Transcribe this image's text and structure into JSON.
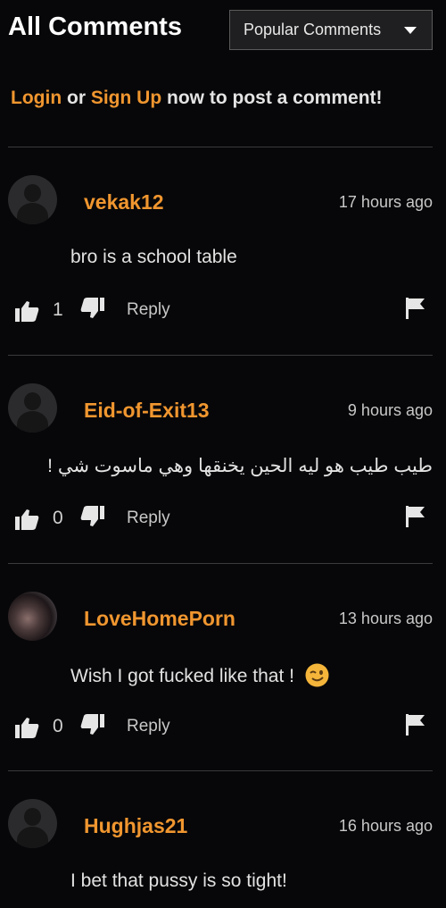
{
  "header": {
    "title": "All Comments",
    "sort_selected": "Popular Comments"
  },
  "login_prompt": {
    "login": "Login",
    "or": "or",
    "sign_up": "Sign Up",
    "rest": "now to post a comment!"
  },
  "colors": {
    "accent": "#f0962f",
    "background": "#070709",
    "divider": "#3a3a3d"
  },
  "comments": [
    {
      "username": "vekak12",
      "time": "17 hours ago",
      "text": "bro is a school table",
      "likes": "1",
      "reply_label": "Reply",
      "avatar": "default-avatar-icon"
    },
    {
      "username": "Eid-of-Exit13",
      "time": "9 hours ago",
      "text": "طيب طيب هو ليه الحين يخنقها وهي ماسوت شي !",
      "likes": "0",
      "reply_label": "Reply",
      "avatar": "default-avatar-icon"
    },
    {
      "username": "LoveHomePorn",
      "time": "13 hours ago",
      "text": "Wish I got fucked like that !",
      "emoji": "winking-face-icon",
      "likes": "0",
      "reply_label": "Reply",
      "avatar": "user-photo"
    },
    {
      "username": "Hughjas21",
      "time": "16 hours ago",
      "text": "I bet that pussy is so tight!",
      "avatar": "default-avatar-icon"
    }
  ]
}
